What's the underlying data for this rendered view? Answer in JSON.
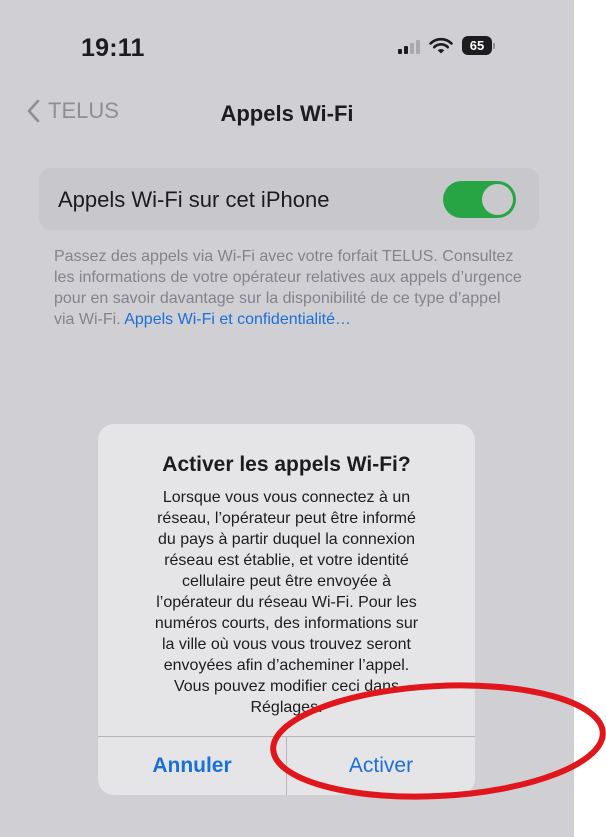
{
  "status_bar": {
    "time": "19:11",
    "battery": "65",
    "icons": [
      "signal-icon",
      "wifi-icon",
      "battery-icon"
    ]
  },
  "nav": {
    "back_label": "TELUS",
    "title": "Appels Wi-Fi",
    "back_icon": "chevron-left-icon"
  },
  "setting": {
    "label": "Appels Wi-Fi sur cet iPhone",
    "toggle_on": true,
    "toggle_color": "#27a545"
  },
  "footer": {
    "text": "Passez des appels via Wi-Fi avec votre forfait TELUS. Consultez les informations de votre opérateur relatives aux appels d’urgence pour en savoir davantage sur la disponibilité de ce type d’appel via Wi-Fi. ",
    "link": "Appels Wi-Fi et confidentialité…"
  },
  "alert": {
    "title": "Activer les appels Wi-Fi?",
    "message": "Lorsque vous vous connectez à un\nréseau, l’opérateur peut être informé\ndu pays à partir duquel la connexion\nréseau est établie, et votre identité\ncellulaire peut être envoyée à\nl’opérateur du réseau Wi-Fi. Pour les\nnuméros courts, des informations sur\nla ville où vous vous trouvez seront\nenvoyées afin d’acheminer l’appel.\nVous pouvez modifier ceci dans\nRéglages.",
    "cancel_label": "Annuler",
    "confirm_label": "Activer"
  },
  "colors": {
    "accent": "#1b6fd8",
    "annotation": "#e0161c"
  }
}
